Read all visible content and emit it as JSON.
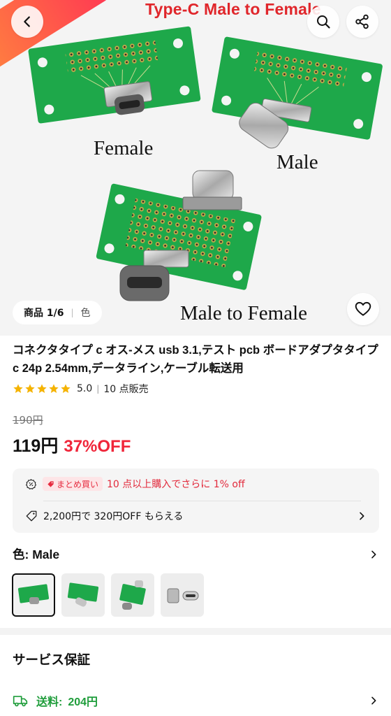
{
  "hero": {
    "title": "Type-C Male to Female",
    "labels": {
      "female": "Female",
      "male": "Male",
      "mtf": "Male to Female"
    },
    "image_counter": "商品 1/6",
    "color_tag": "色"
  },
  "product": {
    "title": "コネクタタイプ c オス-メス usb 3.1,テスト pcb ボードアダプタタイプ c 24p 2.54mm,データライン,ケーブル転送用",
    "rating": "5.0",
    "sold": "10 点販売",
    "old_price": "190円",
    "price": "119円",
    "discount": "37%OFF"
  },
  "promo": {
    "bulk_tag": "まとめ買い",
    "bulk_text": "10 点以上購入でさらに 1% off",
    "coupon_text": "2,200円で 320円OFF もらえる"
  },
  "color_section": {
    "label": "色: Male",
    "options": [
      "female-board",
      "male-board",
      "male-to-female-board",
      "connector-parts"
    ]
  },
  "service": {
    "title": "サービス保証",
    "shipping_label": "送料:",
    "shipping_value": "204円"
  },
  "colors": {
    "accent_red": "#f0263a",
    "shipping_green": "#1f9d3b",
    "pcb_green": "#1ea84a",
    "star_gold": "#f5b301"
  },
  "icons": [
    "back-icon",
    "search-icon",
    "share-icon",
    "heart-icon",
    "star-icon",
    "percent-icon",
    "tag-icon",
    "chevron-right-icon",
    "truck-icon"
  ]
}
